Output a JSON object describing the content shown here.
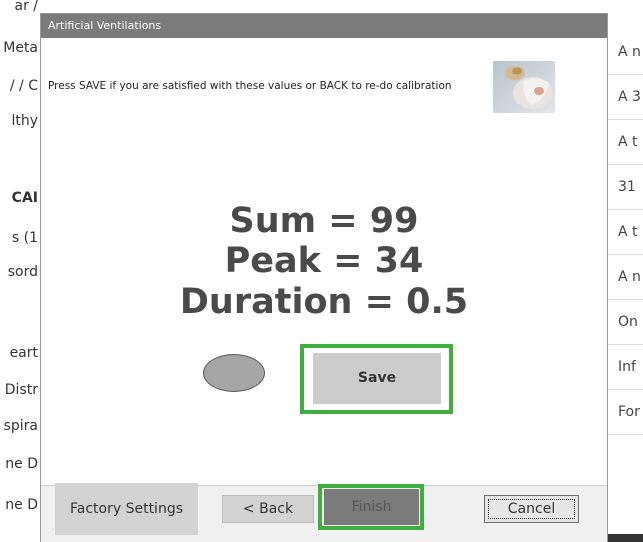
{
  "background_app": {
    "left_items": [
      {
        "text": "ar /",
        "bold": false
      },
      {
        "text": "Meta",
        "bold": false
      },
      {
        "text": "/ / C",
        "bold": false
      },
      {
        "text": "lthy",
        "bold": false
      },
      {
        "text": "CAI",
        "bold": true
      },
      {
        "text": "s (1",
        "bold": false
      },
      {
        "text": "sord",
        "bold": false
      },
      {
        "text": "eart",
        "bold": false
      },
      {
        "text": "Distr",
        "bold": false
      },
      {
        "text": "spira",
        "bold": false
      },
      {
        "text": "ne D",
        "bold": false
      },
      {
        "text": "ne D",
        "bold": false
      }
    ],
    "right_items": [
      "A n",
      "A 3",
      "A t",
      "31",
      "A t",
      "A n",
      "On",
      "Inf",
      "For"
    ]
  },
  "dialog": {
    "title": "Artificial Ventilations",
    "instruction": "Press SAVE if you are satisfied with these values or BACK to re-do calibration",
    "sum_text": "Sum = 99",
    "peak_text": "Peak = 34",
    "duration_text": "Duration = 0.5",
    "save_label": "Save"
  },
  "footer": {
    "factory_label": "Factory Settings",
    "back_label": "< Back",
    "finish_label": "Finish",
    "cancel_label": "Cancel"
  },
  "colors": {
    "titlebar": "#7b7b7b",
    "highlight": "#3fae3f",
    "value_text": "#4a4a4a"
  },
  "icons": {
    "thumbnail": "training-image-icon",
    "indicator": "status-indicator-oval"
  }
}
